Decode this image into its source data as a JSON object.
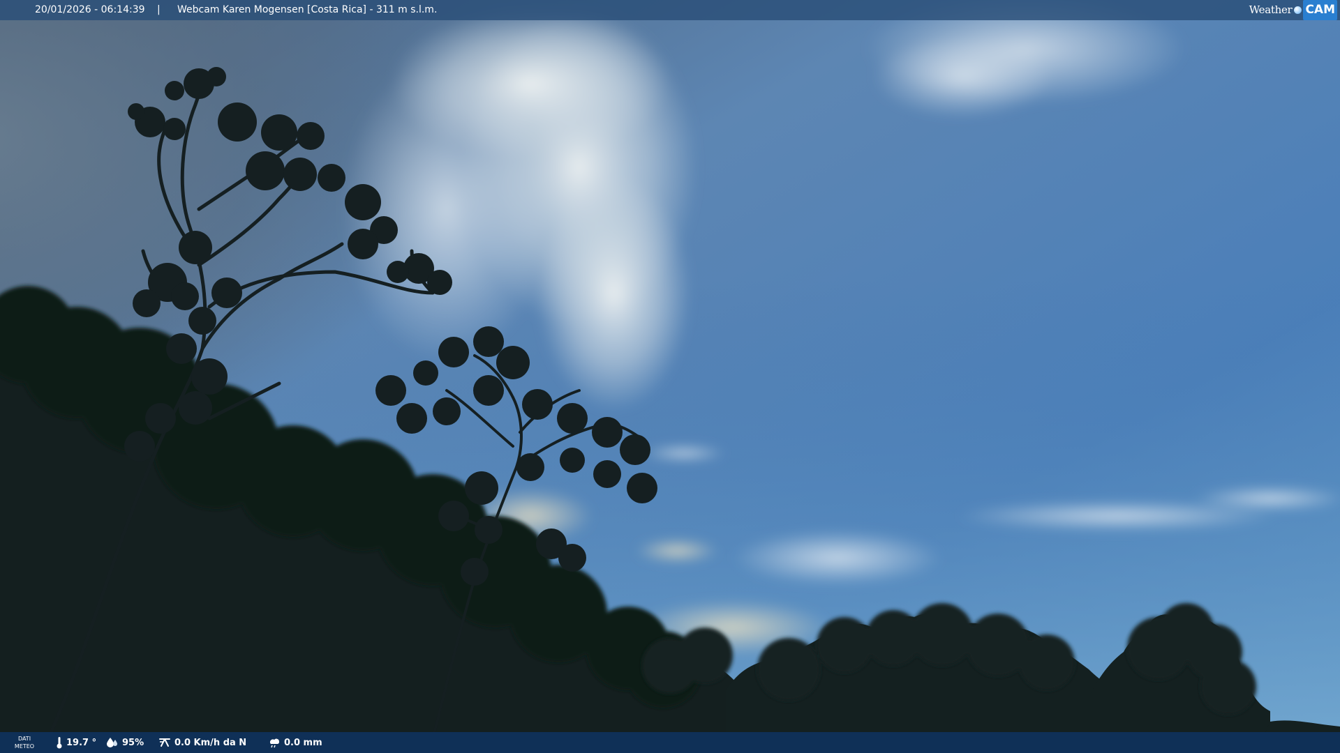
{
  "header": {
    "timestamp": "20/01/2026 - 06:14:39",
    "separator": "|",
    "title": "Webcam Karen Mogensen [Costa Rica] - 311 m s.l.m."
  },
  "logo": {
    "text_part1": "Weather",
    "text_part2": "CAM"
  },
  "footer": {
    "meteo_label_line1": "DATI",
    "meteo_label_line2": "METEO",
    "temperature": "19.7 °",
    "humidity": "95%",
    "wind": "0.0 Km/h da N",
    "rain": "0.0 mm"
  },
  "icons": {
    "temperature": "thermometer-icon",
    "humidity": "humidity-drop-icon",
    "wind": "wind-icon",
    "rain": "rain-cloud-icon"
  },
  "colors": {
    "sky_top": "#3f6fa6",
    "sky_bottom": "#6fa0cc",
    "cloud": "#d9e4ee",
    "foliage": "#121d1c",
    "bar": "#1f4b7e"
  }
}
